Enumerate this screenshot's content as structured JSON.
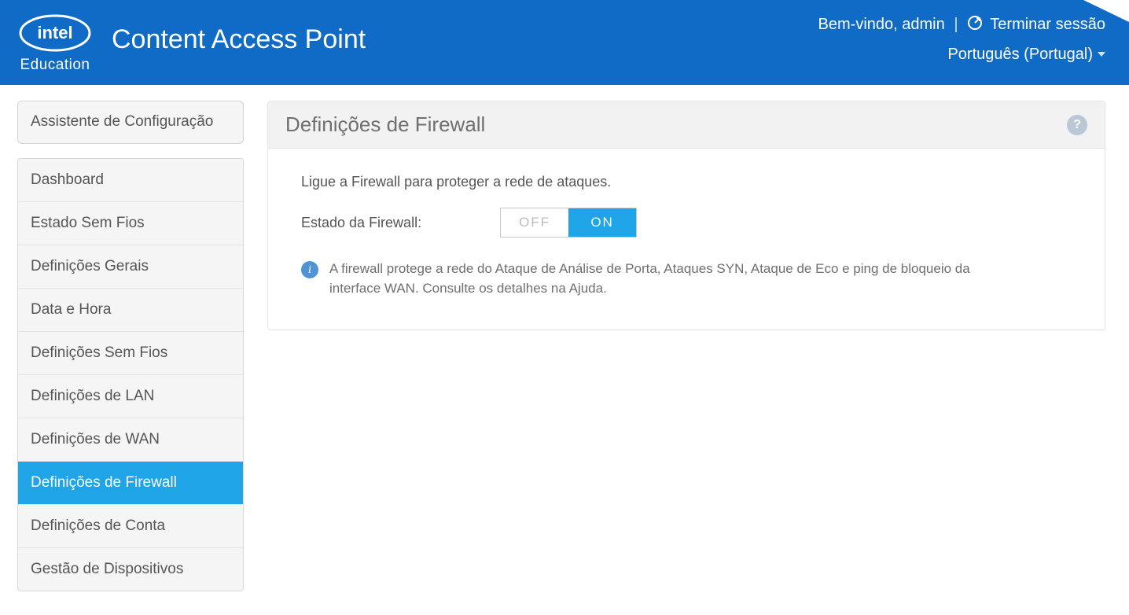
{
  "header": {
    "brand_sub": "Education",
    "app_title": "Content Access Point",
    "welcome_prefix": "Bem-vindo, ",
    "username": "admin",
    "logout_label": "Terminar sessão",
    "language": "Português (Portugal)"
  },
  "sidebar": {
    "wizard_label": "Assistente de Configuração",
    "items": [
      {
        "label": "Dashboard",
        "active": false
      },
      {
        "label": "Estado Sem Fios",
        "active": false
      },
      {
        "label": "Definições Gerais",
        "active": false
      },
      {
        "label": "Data e Hora",
        "active": false
      },
      {
        "label": "Definições Sem Fios",
        "active": false
      },
      {
        "label": "Definições de LAN",
        "active": false
      },
      {
        "label": "Definições de WAN",
        "active": false
      },
      {
        "label": "Definições de Firewall",
        "active": true
      },
      {
        "label": "Definições de Conta",
        "active": false
      },
      {
        "label": "Gestão de Dispositivos",
        "active": false
      }
    ]
  },
  "panel": {
    "title": "Definições de Firewall",
    "help_symbol": "?",
    "instruction": "Ligue a Firewall para proteger a rede de ataques.",
    "status_label": "Estado da Firewall:",
    "toggle_off": "OFF",
    "toggle_on": "ON",
    "toggle_state": "on",
    "info_text": "A firewall protege a rede do Ataque de Análise de Porta, Ataques SYN, Ataque de Eco e ping de bloqueio da interface WAN. Consulte os detalhes na Ajuda."
  }
}
